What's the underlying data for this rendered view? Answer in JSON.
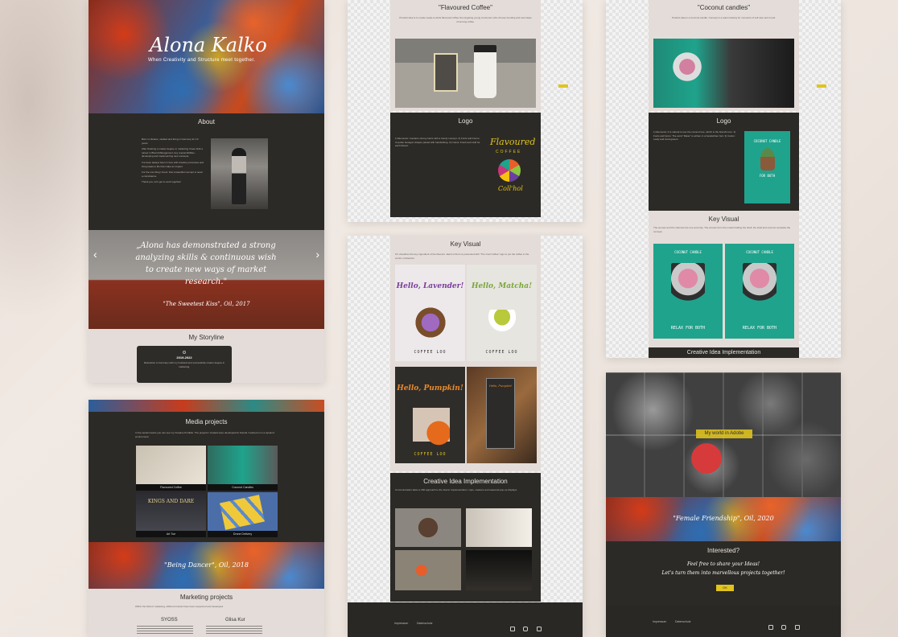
{
  "hero": {
    "name": "Alona Kalko",
    "tagline": "When Creativity and Structure meet together."
  },
  "about": {
    "title": "About",
    "paragraphs": [
      "Born in Ukraine, studied and living in Germany for 10 years.",
      "After finishing a master degree in marketing I have built a career in Brand Management, key responsibilities, developing and implementing new concepts.",
      "I've been always been in love with creative processes and bring ideas to life that make an impact.",
      "For the one thing I know: that a beautiful concept is never a coincidence.",
      "Thank you, let's get to work together!"
    ]
  },
  "slider": {
    "quote": "„Alona has demonstrated a strong analyzing skills & continuous wish to create new ways of market research.\"",
    "painting": "\"The Sweetest Kiss\", Oil, 2017",
    "prev": "‹",
    "next": "›"
  },
  "storyline": {
    "title": "My Storyline",
    "years": "2019-2022",
    "text": "Relocation to Germany with my husband and successfully master degree in marketing."
  },
  "media": {
    "title": "Media projects",
    "intro": "In the section below you can see my Creative Portfolio. The projects I created were developed for brands I worked on in a dynamic environment.",
    "tiles": [
      {
        "caption": "Flavoured Coffee"
      },
      {
        "caption": "Coconut Candles"
      },
      {
        "caption": "Art Tue",
        "overlay": "KINGS AND DARE"
      },
      {
        "caption": "Drone Delivery"
      }
    ],
    "painting": "\"Being Dancer\", Oil, 2018"
  },
  "marketing": {
    "title": "Marketing projects",
    "intro": "Within the field of marketing, different brands have been supported and developed.",
    "col1": "SYOSS",
    "col2": "Glisa Kur"
  },
  "coffee": {
    "title": "\"Flavoured Coffee\"",
    "intro": "Product idea is to create ready-to-drink flavoured coffee line targeting young customers who choose trending and new ideas of serving coffee.",
    "logo_title": "Logo",
    "logo_text": "1) Elements: Contains strong colors with a trendy concept. 2) Fonts and Forms: Cup-like hexagon shapes paired with handwriting. 3) Colors: Fresh and vivid for each flavour.",
    "brand_line1": "Flavoured",
    "brand_line2": "COFFEE",
    "brand_word": "Coll'hol",
    "kv_title": "Key Visual",
    "kv_intro": "KV visualizes the key ingredient of the flavours. Each of them is presented with \"The Cool Coffee\" sign to put the coffee in the centre of attention.",
    "kv": [
      {
        "headline": "Hello, Lavender!",
        "label": "COFFEE LOO"
      },
      {
        "headline": "Hello, Matcha!",
        "label": "COFFEE LOO"
      },
      {
        "headline": "Hello, Pumpkin!",
        "label": "COFFEE LOO"
      },
      {
        "headline": "Hello, Pumpkin!",
        "label": ""
      }
    ],
    "cii_title": "Creative Idea Implementation",
    "cii_intro": "Communication takes a 360 approach to the brand. Implementation: cups, coasters and seasonal pop-up displays.",
    "footer": {
      "imprint": "Impressum",
      "privacy": "Datenschutz"
    }
  },
  "candles": {
    "title": "\"Coconut candles\"",
    "intro": "Product idea is a Coconut candle. Concept is a quiet relaxing for moments of self care and mood.",
    "logo_title": "Logo",
    "logo_text": "1) Elements: It is natural to use the coconut tree, which is the brand's icon. 2) Fonts and forms: The word \"Relax\" is written in a handwritten font. 3) Colors: Leafy and coral greens.",
    "logo_card_title": "COCONUT CANDLE",
    "logo_card_sub": "FOR BOTH",
    "kv_title": "Key Visual",
    "kv_intro": "The woman and the shell are the one and only. The woman from the model holding the shell, the shell and coconut complete the concept.",
    "kv": [
      {
        "top": "COCONUT CANDLE",
        "bottom": "RELAX FOR BOTH"
      },
      {
        "top": "COCONUT CANDLE",
        "bottom": "RELAX FOR BOTH"
      }
    ],
    "cii_title": "Creative Idea Implementation"
  },
  "adobe": {
    "badge": "My world in Adobe",
    "painting": "\"Female Friendship\", Oil, 2020",
    "interested": "Interested?",
    "cta1": "Feel free to share your Ideas!",
    "cta2": "Let's turn them into marvellous projects together!",
    "button": "OK",
    "footer": {
      "imprint": "Impressum",
      "privacy": "Datenschutz"
    }
  },
  "colors": {
    "dark": "#2c2a26",
    "accent": "#e1c41d",
    "teal": "#1fa38c"
  }
}
